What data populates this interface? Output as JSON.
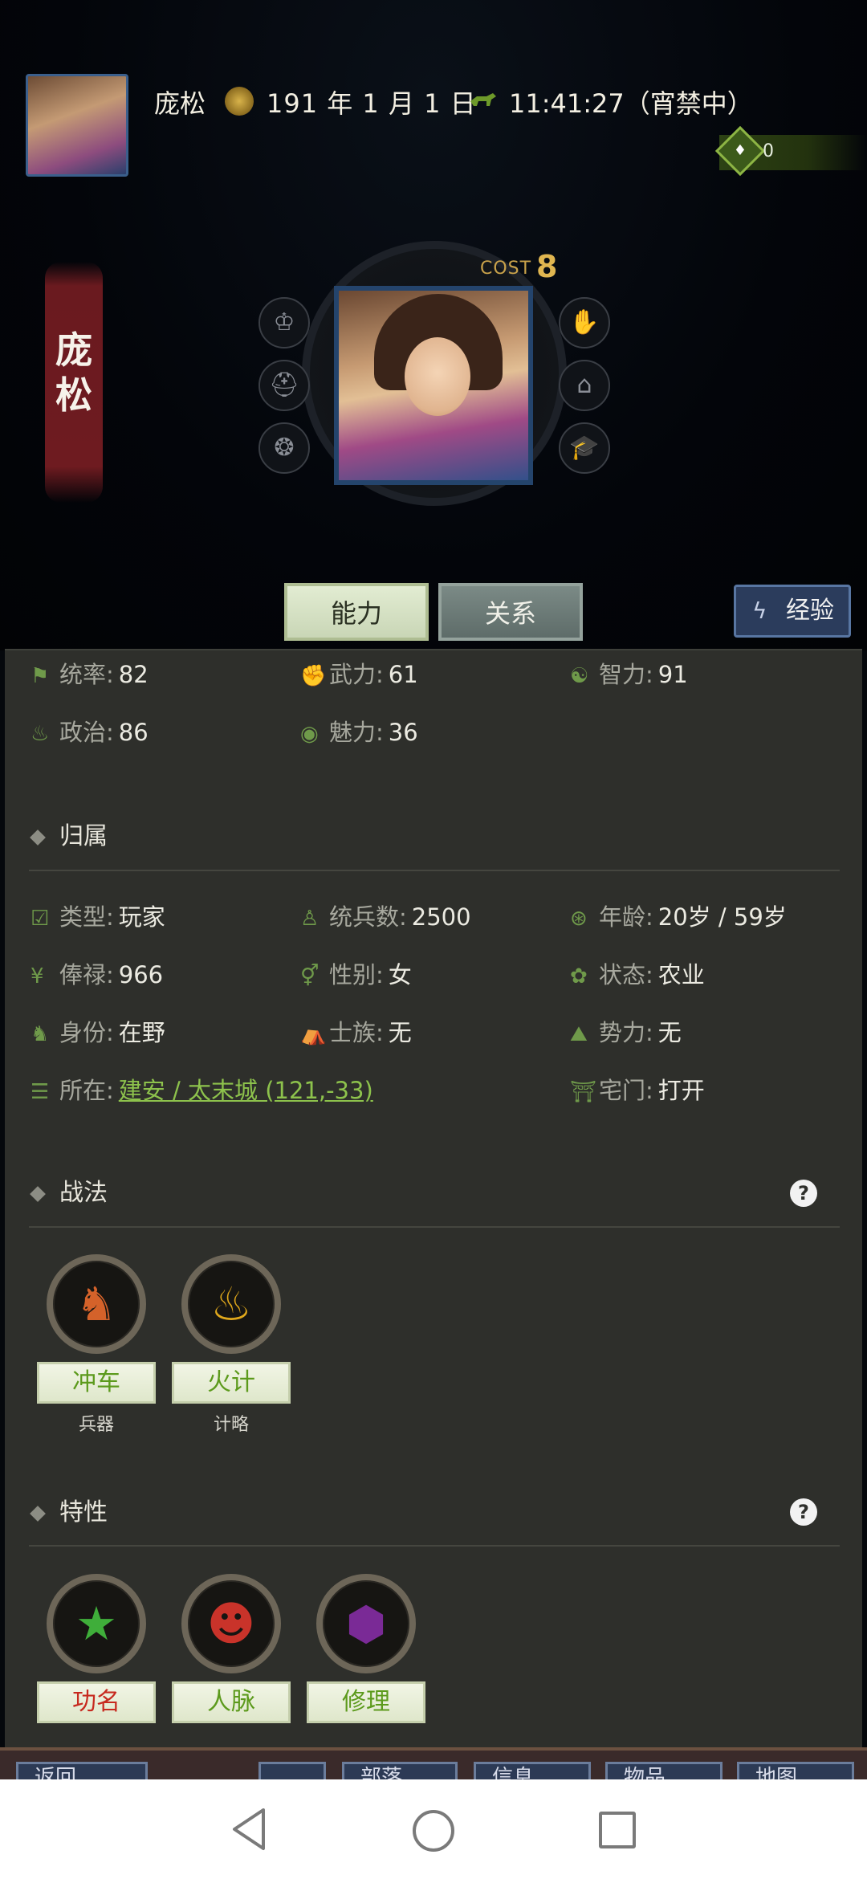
{
  "header": {
    "name": "庞松",
    "date": "191 年 1 月 1 日",
    "time": "11:41:27（宵禁中）",
    "coins": "0"
  },
  "banner": {
    "line1": "庞",
    "line2": "松"
  },
  "portrait": {
    "cost_label": "COST",
    "cost_value": "8"
  },
  "tabs": {
    "ability": "能力",
    "relation": "关系",
    "exp": "经验"
  },
  "stats": [
    {
      "label": "统率:",
      "value": "82",
      "icon": "flag-icon"
    },
    {
      "label": "武力:",
      "value": "61",
      "icon": "arm-icon"
    },
    {
      "label": "智力:",
      "value": "91",
      "icon": "brain-icon"
    },
    {
      "label": "政治:",
      "value": "86",
      "icon": "pot-icon"
    },
    {
      "label": "魅力:",
      "value": "36",
      "icon": "eye-icon"
    }
  ],
  "affiliation": {
    "title": "归属",
    "items": [
      {
        "label": "类型:",
        "value": "玩家",
        "icon": "calendar-check-icon"
      },
      {
        "label": "统兵数:",
        "value": "2500",
        "icon": "person-icon"
      },
      {
        "label": "年龄:",
        "value": "20岁 / 59岁",
        "icon": "age-icon"
      },
      {
        "label": "俸禄:",
        "value": "966",
        "icon": "yen-icon"
      },
      {
        "label": "性别:",
        "value": "女",
        "icon": "gender-icon"
      },
      {
        "label": "状态:",
        "value": "农业",
        "icon": "status-icon"
      },
      {
        "label": "身份:",
        "value": "在野",
        "icon": "horse-chess-icon"
      },
      {
        "label": "士族:",
        "value": "无",
        "icon": "clan-icon"
      },
      {
        "label": "势力:",
        "value": "无",
        "icon": "mountain-icon"
      },
      {
        "label": "所在:",
        "value": "建安 / 太末城 (121,-33)",
        "icon": "road-icon"
      },
      {
        "label": "宅门:",
        "value": "打开",
        "icon": "gate-icon"
      }
    ]
  },
  "tactics": {
    "title": "战法",
    "help": "?",
    "items": [
      {
        "label": "冲车",
        "sub": "兵器",
        "icon": "siege-horse-icon"
      },
      {
        "label": "火计",
        "sub": "计略",
        "icon": "fire-icon"
      }
    ]
  },
  "traits": {
    "title": "特性",
    "help": "?",
    "items": [
      {
        "label": "功名",
        "icon": "officer-cap-icon"
      },
      {
        "label": "人脉",
        "icon": "people-icon"
      },
      {
        "label": "修理",
        "icon": "repair-icon"
      }
    ]
  },
  "bottom_nav": [
    "返回",
    "",
    "部落",
    "信息",
    "物品",
    "地图"
  ],
  "colors": {
    "panel_bg": "#2e2f2b",
    "accent_green": "#8dc24c",
    "trait_red": "#c72a1f",
    "tactic_green": "#5c9a1c"
  }
}
